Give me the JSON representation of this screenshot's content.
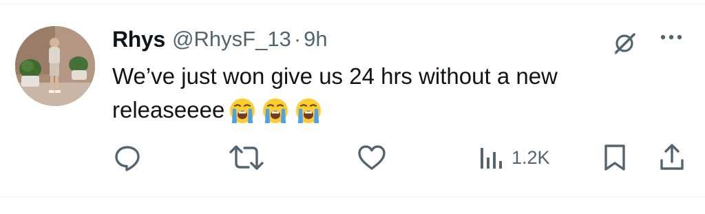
{
  "tweet": {
    "author": {
      "display_name": "Rhys",
      "handle": "@RhysF_13"
    },
    "separator": "·",
    "time": "9h",
    "text": "We’ve just won give us 24 hrs without a new releaseeee",
    "emojis": [
      "loudly-crying-face",
      "loudly-crying-face",
      "loudly-crying-face"
    ]
  },
  "actions": {
    "views": "1.2K"
  },
  "icons": {
    "reply": "reply-icon",
    "retweet": "retweet-icon",
    "like": "heart-icon",
    "views": "views-bar-chart-icon",
    "bookmark": "bookmark-icon",
    "share": "share-icon",
    "grok": "grok-icon",
    "more": "more-dots-icon"
  },
  "colors": {
    "text_primary": "#0f1419",
    "text_secondary": "#536471",
    "divider": "#eff3f4"
  }
}
